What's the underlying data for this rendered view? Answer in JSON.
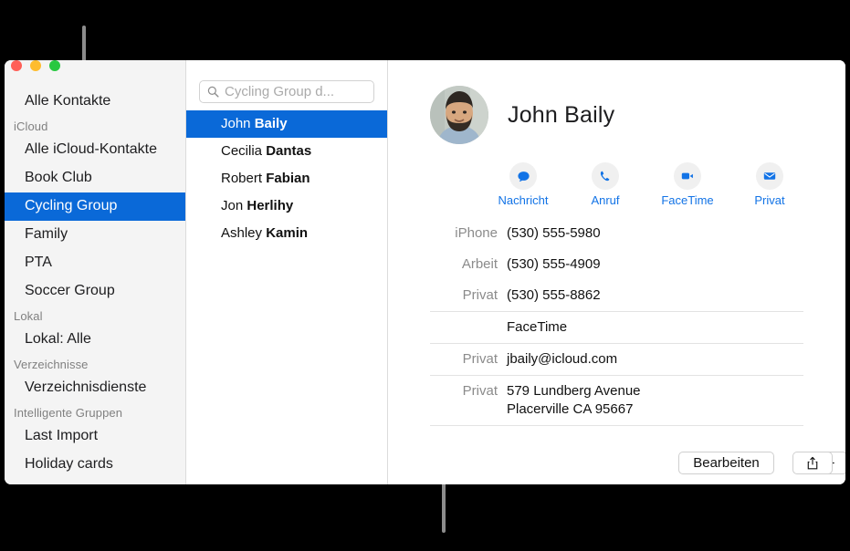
{
  "window": {
    "traffic_lights": [
      {
        "name": "close",
        "color": "#ff5f57"
      },
      {
        "name": "minimize",
        "color": "#febc2e"
      },
      {
        "name": "zoom",
        "color": "#28c840"
      }
    ]
  },
  "sidebar": {
    "top_item": "Alle Kontakte",
    "groups": [
      {
        "header": "iCloud",
        "items": [
          {
            "label": "Alle iCloud-Kontakte",
            "selected": false
          },
          {
            "label": "Book Club",
            "selected": false
          },
          {
            "label": "Cycling Group",
            "selected": true
          },
          {
            "label": "Family",
            "selected": false
          },
          {
            "label": "PTA",
            "selected": false
          },
          {
            "label": "Soccer Group",
            "selected": false
          }
        ]
      },
      {
        "header": "Lokal",
        "items": [
          {
            "label": "Lokal: Alle",
            "selected": false
          }
        ]
      },
      {
        "header": "Verzeichnisse",
        "items": [
          {
            "label": "Verzeichnisdienste",
            "selected": false
          }
        ]
      },
      {
        "header": "Intelligente Gruppen",
        "items": [
          {
            "label": "Last Import",
            "selected": false
          },
          {
            "label": "Holiday cards",
            "selected": false
          }
        ]
      }
    ],
    "selection_color": "#0a69d8"
  },
  "contact_list": {
    "search": {
      "placeholder": "Cycling Group d...",
      "value": "",
      "icon": "search-icon"
    },
    "contacts": [
      {
        "first": "John ",
        "last": "Baily",
        "selected": true
      },
      {
        "first": "Cecilia ",
        "last": "Dantas",
        "selected": false
      },
      {
        "first": "Robert ",
        "last": "Fabian",
        "selected": false
      },
      {
        "first": "Jon ",
        "last": "Herlihy",
        "selected": false
      },
      {
        "first": "Ashley ",
        "last": "Kamin",
        "selected": false
      }
    ]
  },
  "detail": {
    "name": "John Baily",
    "avatar_alt": "photo of bearded man",
    "actions": [
      {
        "label": "Nachricht",
        "icon": "message-bubble-icon"
      },
      {
        "label": "Anruf",
        "icon": "phone-icon"
      },
      {
        "label": "FaceTime",
        "icon": "video-camera-icon"
      },
      {
        "label": "Privat",
        "icon": "envelope-icon"
      }
    ],
    "action_color": "#1273e6",
    "fields": [
      {
        "label": "iPhone",
        "value": "(530) 555-5980"
      },
      {
        "label": "Arbeit",
        "value": "(530) 555-4909"
      },
      {
        "label": "Privat",
        "value": "(530) 555-8862"
      },
      {
        "label": "",
        "value": "FaceTime"
      },
      {
        "label": "Privat",
        "value": "jbaily@icloud.com"
      },
      {
        "label": "Privat",
        "value": "579 Lundberg Avenue\nPlacerville CA 95667"
      }
    ]
  },
  "bottom_bar": {
    "add_label": "+",
    "edit_label": "Bearbeiten",
    "share_icon": "share-icon"
  }
}
